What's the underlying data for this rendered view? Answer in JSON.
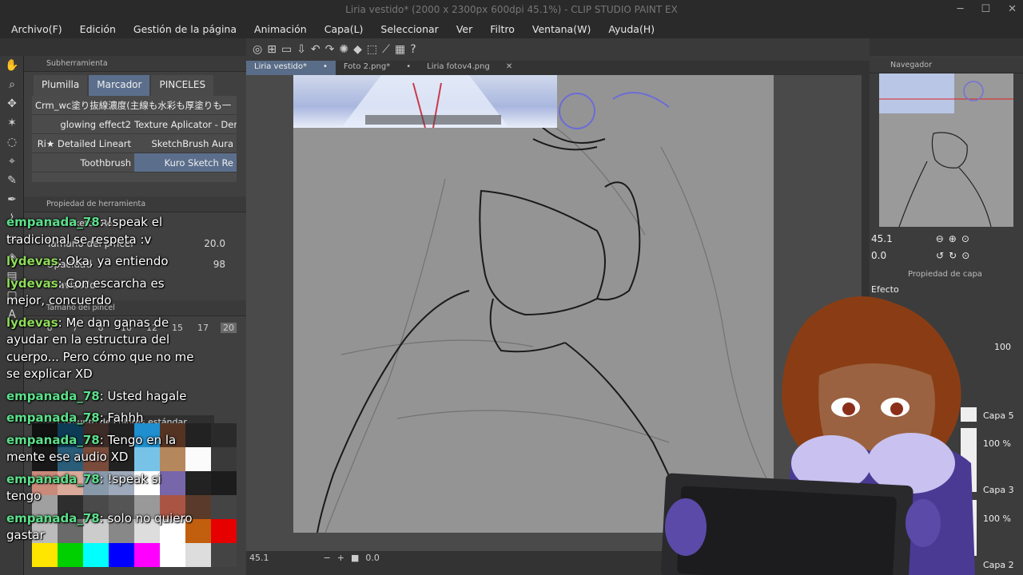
{
  "window": {
    "title": "Liria vestido* (2000 x 2300px 600dpi 45.1%) - CLIP STUDIO PAINT EX"
  },
  "menu": [
    "Archivo(F)",
    "Edición",
    "Gestión de la página",
    "Animación",
    "Capa(L)",
    "Seleccionar",
    "Ver",
    "Filtro",
    "Ventana(W)",
    "Ayuda(H)"
  ],
  "subtool": {
    "header": "Subherramienta",
    "tabs": [
      "Plumilla",
      "Marcador",
      "PINCELES"
    ],
    "brushes": [
      "Crm_wc塗り抜線濃度(主線も水彩も厚塗りも一",
      "glowing effect2",
      "Texture Aplicator - Den",
      "Ri★ Detailed Lineart",
      "SketchBrush Aura",
      "Toothbrush",
      "Kuro Sketch Re"
    ]
  },
  "tool_property": {
    "header": "Propiedad de herramienta",
    "brush_name": "Kuro Sketch Re",
    "size_label": "Tamaño del pincel",
    "size_value": "20.0",
    "opacity_label": "Opacidad",
    "opacity_value": "98",
    "smoothing_label": "Suavizado",
    "brush_size_header": "Tamaño del pincel",
    "sizes": [
      "6",
      "7",
      "8",
      "10",
      "12",
      "15",
      "17",
      "20"
    ]
  },
  "color_set": {
    "name": "Conjunto de colores estándar",
    "swatches": [
      "#111111",
      "#0d3b56",
      "#3c2b26",
      "#222222",
      "#1f8fcf",
      "#553322",
      "#222222",
      "#2a2a2a",
      "#181818",
      "#2a5d7a",
      "#7a4b3b",
      "#222222",
      "#77c3e8",
      "#b5875d",
      "#fbfbfb",
      "#3a3a3a",
      "#c98a7a",
      "#d9aa9a",
      "#8899aa",
      "#9eaabb",
      "#ffffff",
      "#7766aa",
      "#222222",
      "#1c1c1c",
      "#a0a0a0",
      "#2e2e2e",
      "#4a4a4a",
      "#555555",
      "#999999",
      "#aa5544",
      "#5a3a2a",
      "#444444",
      "#bbbbbb",
      "#6a6a6a",
      "#cccccc",
      "#888888",
      "#dddddd",
      "#ffffff",
      "#c25f0e",
      "#e60000",
      "#ffe600",
      "#00d000",
      "#00ffff",
      "#0000ff",
      "#ff00ff",
      "#ffffff",
      "#dddddd",
      "#444444"
    ]
  },
  "doc_tabs": [
    "Liria vestido*",
    "Foto 2.png*",
    "Liria fotov4.png"
  ],
  "status": {
    "zoom": "45.1",
    "angle": "0.0"
  },
  "navigator": {
    "title": "Navegador",
    "zoom": "45.1",
    "angle": "0.0"
  },
  "layer_panel": {
    "title": "Propiedad de capa",
    "effect_label": "Efecto",
    "opacity": "100",
    "layers": [
      {
        "name": "Capa 5"
      },
      {
        "name": "Capa 3",
        "pct": "100 %"
      },
      {
        "name": "Capa 2",
        "pct": "100 %"
      }
    ]
  },
  "chat": [
    {
      "user": "empanada_78",
      "text": "!speak el tradicional se respeta :v"
    },
    {
      "user": "lydevas",
      "text": "Oka, ya entiendo"
    },
    {
      "user": "lydevas",
      "text": "Con escarcha es mejor, concuerdo"
    },
    {
      "user": "lydevas",
      "text": "Me dan ganas de ayudar en la estructura del cuerpo... Pero cómo que no me se explicar XD"
    },
    {
      "user": "empanada_78",
      "text": "Usted hagale"
    },
    {
      "user": "empanada_78",
      "text": "Fahhh"
    },
    {
      "user": "empanada_78",
      "text": "Tengo en la mente ese audio XD"
    },
    {
      "user": "empanada_78",
      "text": "!speak si tengo"
    },
    {
      "user": "empanada_78",
      "text": "solo no quiero gastar"
    }
  ]
}
